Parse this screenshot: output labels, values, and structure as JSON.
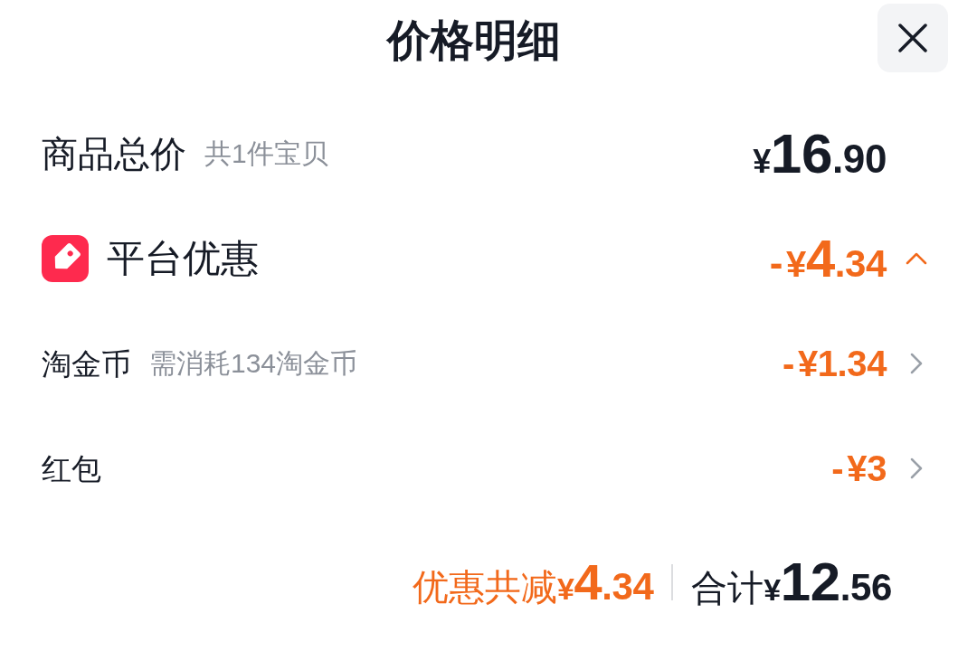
{
  "header": {
    "title": "价格明细"
  },
  "rows": [
    {
      "kind": "subtotal",
      "label": "商品总价",
      "note": "共1件宝贝",
      "amount": {
        "currency": "¥",
        "whole": "16",
        "fraction": ".90"
      }
    },
    {
      "kind": "discount_group",
      "label": "平台优惠",
      "expanded": true,
      "amount": {
        "sign": "-",
        "currency": "¥",
        "whole": "4",
        "fraction": ".34"
      },
      "children": [
        {
          "kind": "discount",
          "label": "淘金币",
          "note": "需消耗134淘金币",
          "amount": {
            "sign": "-",
            "currency": "¥",
            "whole": "1",
            "fraction": ".34"
          }
        },
        {
          "kind": "discount",
          "label": "红包",
          "amount": {
            "sign": "-",
            "currency": "¥",
            "whole": "3"
          }
        }
      ]
    }
  ],
  "footer": {
    "saving": {
      "label": "优惠共减",
      "amount": {
        "currency": "¥",
        "whole": "4",
        "fraction": ".34"
      }
    },
    "total": {
      "label": "合计",
      "amount": {
        "currency": "¥",
        "whole": "12",
        "fraction": ".56"
      }
    }
  }
}
